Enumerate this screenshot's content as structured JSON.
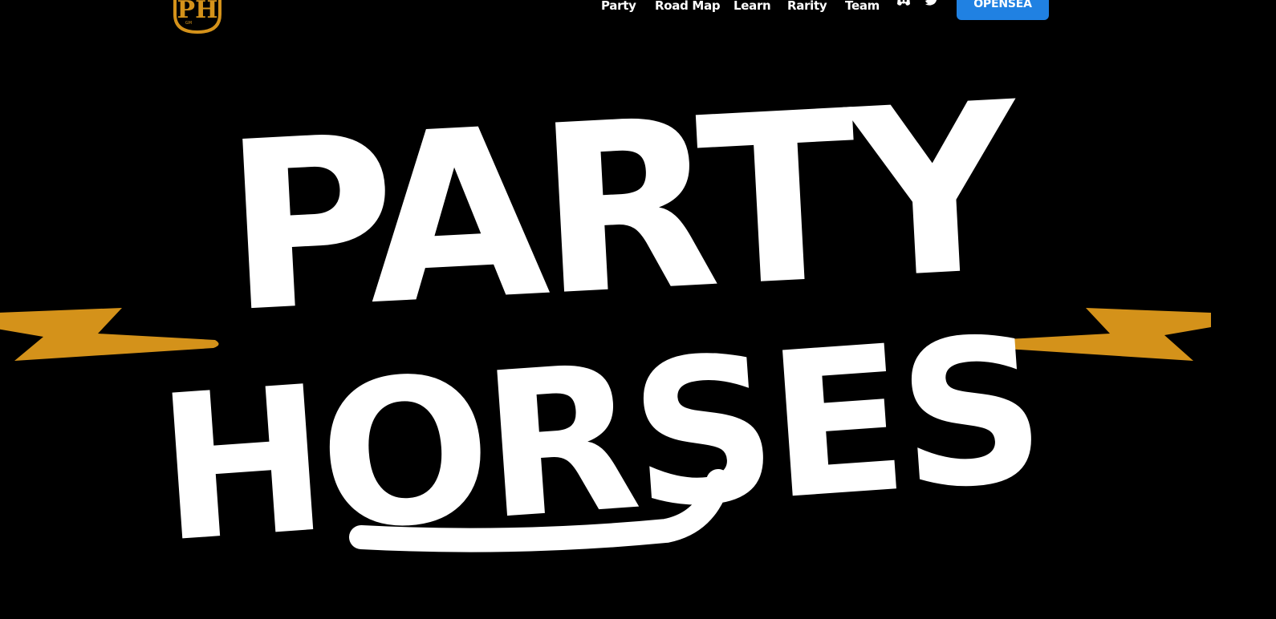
{
  "logo": {
    "text": "PH",
    "small_text": "GM",
    "color": "#d4921a"
  },
  "nav": {
    "items": [
      {
        "label": "Party"
      },
      {
        "label": "Road Map"
      },
      {
        "label": "Learn"
      },
      {
        "label": "Rarity"
      },
      {
        "label": "Team"
      }
    ],
    "social": [
      {
        "icon": "discord-icon"
      },
      {
        "icon": "twitter-icon"
      }
    ],
    "cta": {
      "label": "OPENSEA",
      "color": "#2081e2"
    }
  },
  "hero": {
    "line1": "PARTY",
    "line2": "HORSES",
    "text_color": "#ffffff",
    "accent_color": "#d4921a"
  }
}
